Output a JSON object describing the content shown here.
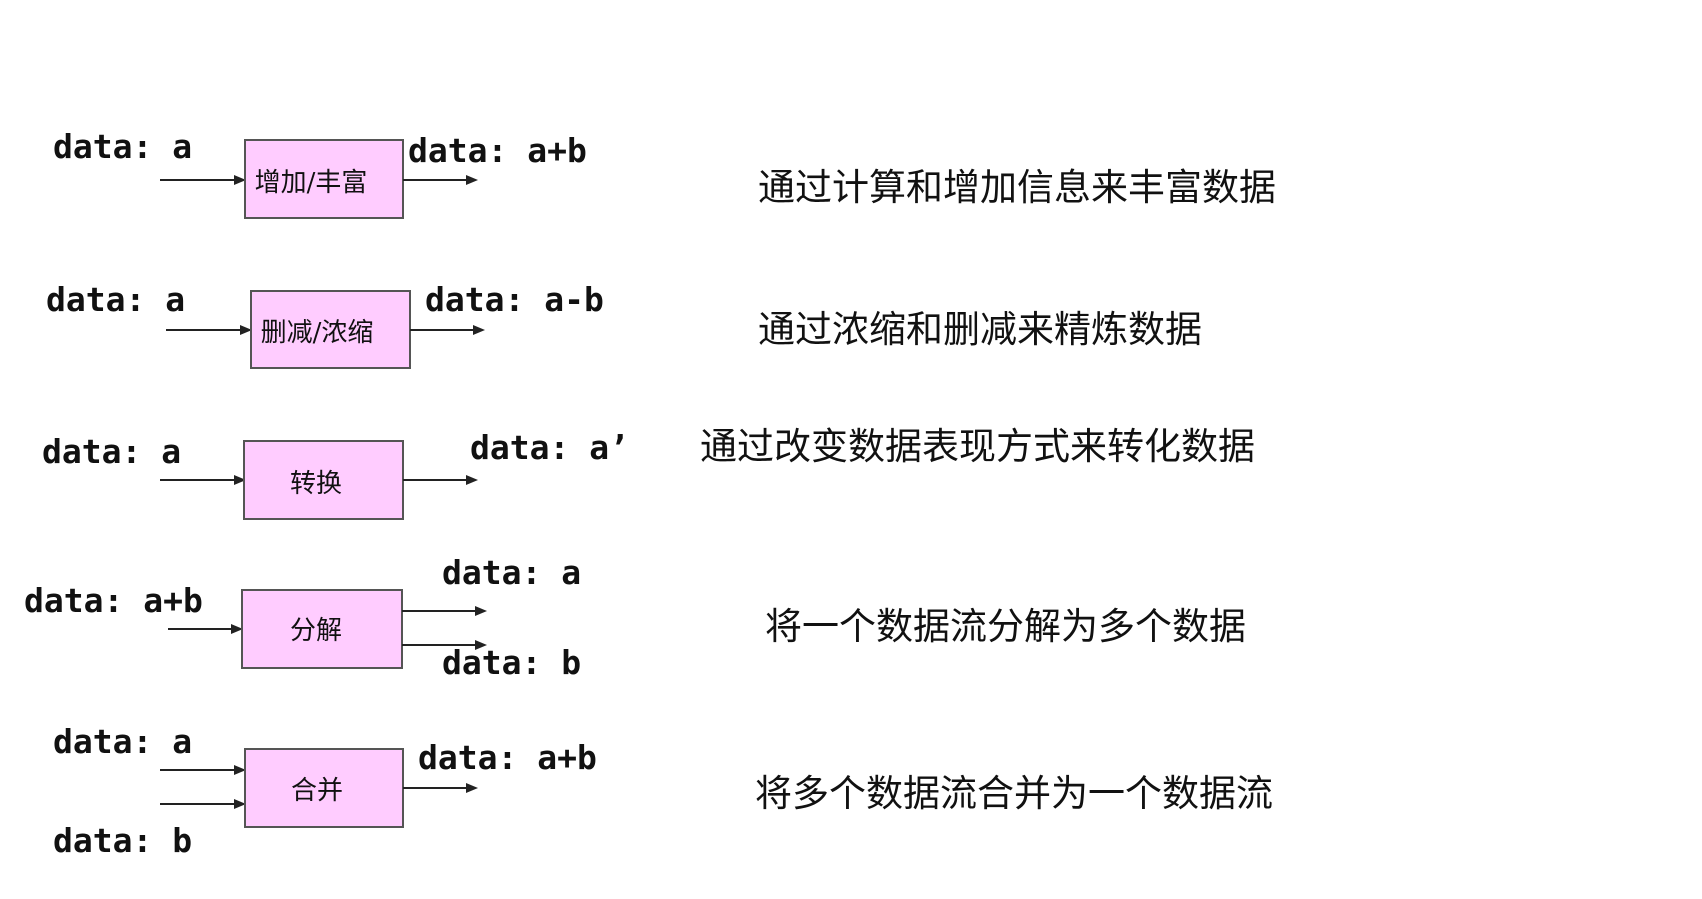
{
  "rows": [
    {
      "input_labels": [
        "data: a"
      ],
      "box_label": "增加/丰富",
      "output_labels": [
        "data: a+b"
      ],
      "description": "通过计算和增加信息来丰富数据"
    },
    {
      "input_labels": [
        "data: a"
      ],
      "box_label": "删减/浓缩",
      "output_labels": [
        "data: a-b"
      ],
      "description": "通过浓缩和删减来精炼数据"
    },
    {
      "input_labels": [
        "data: a"
      ],
      "box_label": "转换",
      "output_labels": [
        "data: a’"
      ],
      "description": "通过改变数据表现方式来转化数据"
    },
    {
      "input_labels": [
        "data: a+b"
      ],
      "box_label": "分解",
      "output_labels": [
        "data: a",
        "data: b"
      ],
      "description": "将一个数据流分解为多个数据"
    },
    {
      "input_labels": [
        "data: a",
        "data: b"
      ],
      "box_label": "合并",
      "output_labels": [
        "data: a+b"
      ],
      "description": "将多个数据流合并为一个数据流"
    }
  ],
  "colors": {
    "box_fill": "#ffccff",
    "box_stroke": "#555555",
    "arrow": "#222222",
    "text": "#111111"
  }
}
